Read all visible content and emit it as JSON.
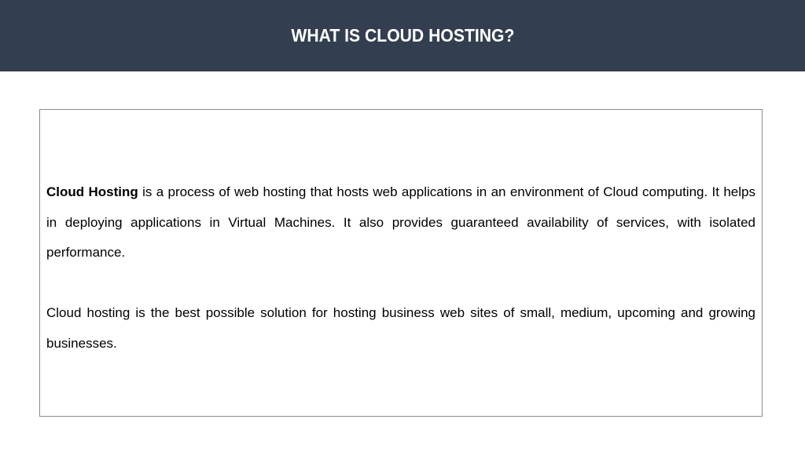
{
  "header": {
    "title": "WHAT IS CLOUD HOSTING?"
  },
  "content": {
    "paragraph1": {
      "bold_term": "Cloud Hosting",
      "text": " is a process of web hosting that hosts web applications in an environment of Cloud computing. It helps in deploying applications in Virtual Machines. It also provides guaranteed availability of services, with isolated performance."
    },
    "paragraph2": {
      "text": "Cloud hosting is the best possible solution for hosting business web sites of small, medium, upcoming and growing businesses."
    }
  },
  "colors": {
    "header_background": "#333f50",
    "header_text": "#ffffff",
    "box_border": "#8c8c8c",
    "body_text": "#000000"
  }
}
